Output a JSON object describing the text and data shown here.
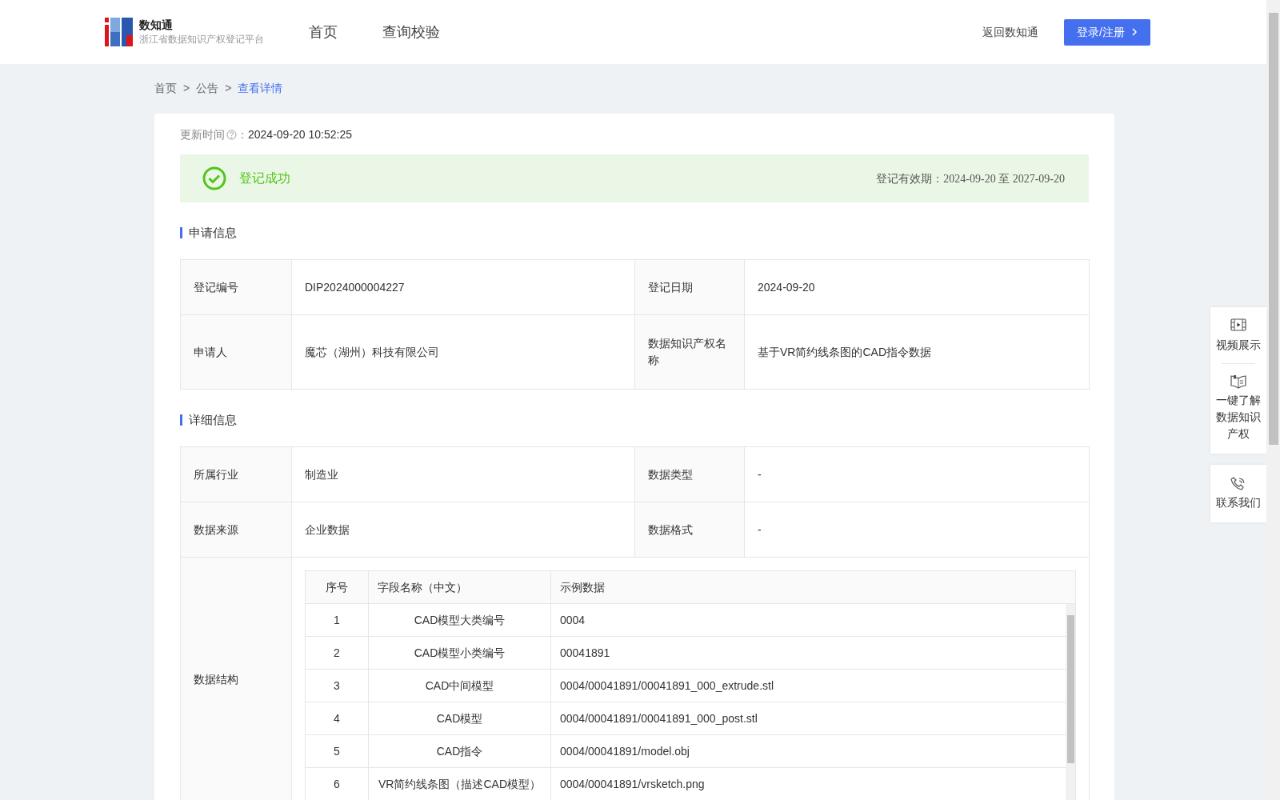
{
  "header": {
    "logo_title": "数知通",
    "logo_subtitle": "浙江省数据知识产权登记平台",
    "nav": [
      {
        "label": "首页",
        "selected": false
      },
      {
        "label": "查询校验",
        "selected": false
      }
    ],
    "back_link": "返回数知通",
    "login_button": "登录/注册"
  },
  "breadcrumb": [
    {
      "label": "首页",
      "current": false
    },
    {
      "label": "公告",
      "current": false
    },
    {
      "label": "查看详情",
      "current": true
    }
  ],
  "breadcrumb_separators": [
    ">",
    ">"
  ],
  "update": {
    "label": "更新时间",
    "colon": "：",
    "time": "2024-09-20 10:52:25"
  },
  "status": {
    "kind": "success",
    "text": "登记成功",
    "validity_label": "登记有效期：",
    "validity_value": "2024-09-20 至 2027-09-20"
  },
  "application": {
    "title": "申请信息",
    "rows": [
      [
        {
          "label": "登记编号",
          "value": "DIP2024000004227"
        },
        {
          "label": "登记日期",
          "value": "2024-09-20"
        }
      ],
      [
        {
          "label": "申请人",
          "value": "魔芯（湖州）科技有限公司"
        },
        {
          "label": "数据知识产权名称",
          "value": "基于VR简约线条图的CAD指令数据"
        }
      ]
    ]
  },
  "details": {
    "title": "详细信息",
    "rows": [
      [
        {
          "label": "所属行业",
          "value": "制造业"
        },
        {
          "label": "数据类型",
          "value": "-"
        }
      ],
      [
        {
          "label": "数据来源",
          "value": "企业数据"
        },
        {
          "label": "数据格式",
          "value": "-"
        }
      ]
    ],
    "structure": {
      "label": "数据结构",
      "columns": [
        "序号",
        "字段名称（中文）",
        "示例数据"
      ],
      "rows": [
        [
          "1",
          "CAD模型大类编号",
          "0004"
        ],
        [
          "2",
          "CAD模型小类编号",
          "00041891"
        ],
        [
          "3",
          "CAD中间模型",
          "0004/00041891/00041891_000_extrude.stl"
        ],
        [
          "4",
          "CAD模型",
          "0004/00041891/00041891_000_post.stl"
        ],
        [
          "5",
          "CAD指令",
          "0004/00041891/model.obj"
        ],
        [
          "6",
          "VR简约线条图（描述CAD模型）",
          "0004/00041891/vrsketch.png"
        ]
      ]
    }
  },
  "side_panel": [
    [
      {
        "kind": "video",
        "label": "视频展示"
      },
      {
        "kind": "book",
        "label": "一键了解数据知识产权"
      }
    ],
    [
      {
        "kind": "phone",
        "label": "联系我们"
      }
    ]
  ]
}
